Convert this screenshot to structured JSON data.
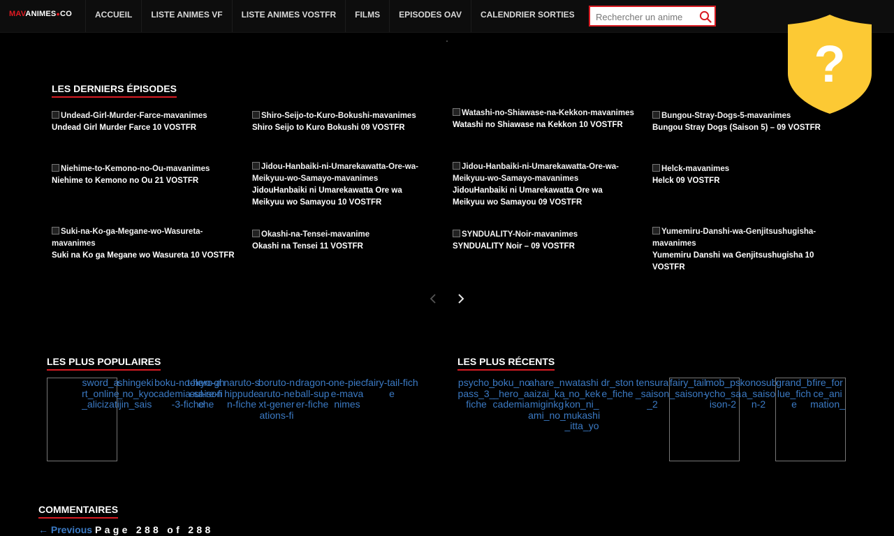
{
  "header": {
    "logo": {
      "part1": "MAV",
      "part2": "ANIMES",
      "dot": "●",
      "part3": "CO"
    },
    "nav": [
      "ACCUEIL",
      "LISTE ANIMES VF",
      "LISTE ANIMES VOSTFR",
      "FILMS",
      "EPISODES OAV",
      "CALENDRIER SORTIES"
    ],
    "search_placeholder": "Rechercher un anime"
  },
  "shield": {
    "glyph": "?",
    "color": "#fcc934"
  },
  "latest": {
    "heading": "LES DERNIERS ÉPISODES",
    "items": [
      {
        "alt": "Undead-Girl-Murder-Farce-mavanimes",
        "title": "Undead Girl Murder Farce 10 VOSTFR"
      },
      {
        "alt": "Shiro-Seijo-to-Kuro-Bokushi-mavanimes",
        "title": "Shiro Seijo to Kuro Bokushi 09 VOSTFR"
      },
      {
        "alt": "Watashi-no-Shiawase-na-Kekkon-mavanimes",
        "title": "Watashi no Shiawase na Kekkon 10 VOSTFR"
      },
      {
        "alt": "Bungou-Stray-Dogs-5-mavanimes",
        "title": "Bungou Stray Dogs (Saison 5) – 09 VOSTFR"
      },
      {
        "alt": "Niehime-to-Kemono-no-Ou-mavanimes",
        "title": "Niehime to Kemono no Ou 21 VOSTFR"
      },
      {
        "alt": "Jidou-Hanbaiki-ni-Umarekawatta-Ore-wa-Meikyuu-wo-Samayo-mavanimes",
        "title": "JidouHanbaiki ni Umarekawatta Ore wa Meikyuu wo Samayou 10 VOSTFR"
      },
      {
        "alt": "Jidou-Hanbaiki-ni-Umarekawatta-Ore-wa-Meikyuu-wo-Samayo-mavanimes",
        "title": "JidouHanbaiki ni Umarekawatta Ore wa Meikyuu wo Samayou 09 VOSTFR"
      },
      {
        "alt": "Helck-mavanimes",
        "title": "Helck 09 VOSTFR"
      },
      {
        "alt": "Suki-na-Ko-ga-Megane-wo-Wasureta-mavanimes",
        "title": "Suki na Ko ga Megane wo Wasureta 10 VOSTFR"
      },
      {
        "alt": "Okashi-na-Tensei-mavanime",
        "title": "Okashi na Tensei 11 VOSTFR"
      },
      {
        "alt": "SYNDUALITY-Noir-mavanimes",
        "title": "SYNDUALITY Noir – 09 VOSTFR"
      },
      {
        "alt": "Yumemiru-Danshi-wa-Genjitsushugisha-mavanimes",
        "title": "Yumemiru Danshi wa Genjitsushugisha 10 VOSTFR"
      }
    ]
  },
  "popular": {
    "heading": "LES PLUS POPULAIRES",
    "thumbs": [
      {
        "alt": "sword_art_online_alicization_fiche"
      },
      {
        "alt": "shingeki_no_kyojin_saison_3"
      },
      {
        "alt": "boku-no-hero-academia-saison-3-fiche"
      },
      {
        "alt": "tokyo-ghoul-re-fiche"
      },
      {
        "alt": "naruto-shippuden-fiche"
      },
      {
        "alt": "boruto-naruto-next-generations-fiche"
      },
      {
        "alt": "dragon-ball-super-fiche"
      },
      {
        "alt": "one-piece-mavanimes"
      },
      {
        "alt": "fairy-tail-fiche"
      }
    ]
  },
  "recent": {
    "heading": "LES PLUS RÉCENTS",
    "thumbs": [
      {
        "alt": "psycho_pass_3_fiche"
      },
      {
        "alt": "boku_no_hero_academia_4_fiche"
      },
      {
        "alt": "ahare_naizai_kamiginkgami_no_in_fiche"
      },
      {
        "alt": "watashi_no_kekkon_ni_mukashi_itta_yo_ne_fiche"
      },
      {
        "alt": "dr_stone_fiche"
      },
      {
        "alt": "tensura_saison_2"
      },
      {
        "alt": "fairy_tail_saison-2"
      },
      {
        "alt": "mob_psycho_saison-2"
      },
      {
        "alt": "konosuba_saison-2"
      },
      {
        "alt": "grand_blue_fiche"
      },
      {
        "alt": "fire_force_animation_saison-2"
      }
    ]
  },
  "comments": {
    "heading": "COMMENTAIRES",
    "previous_label": "← Previous",
    "page_info": "Page 288 of 288"
  }
}
